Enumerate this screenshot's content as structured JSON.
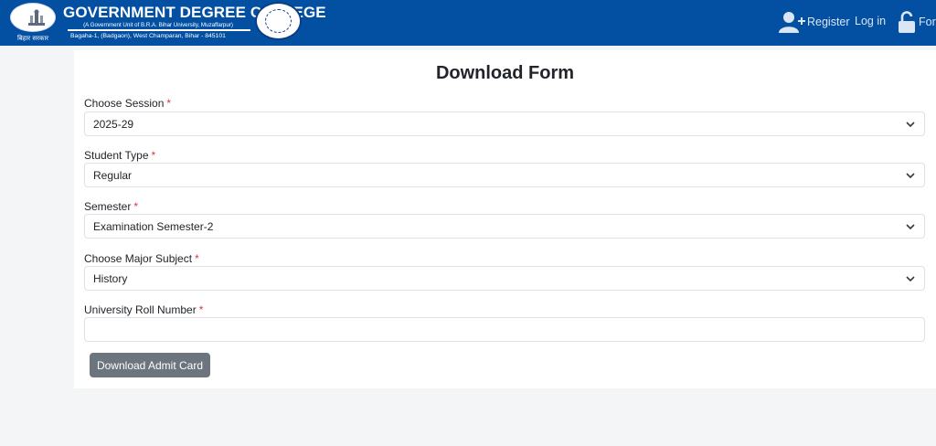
{
  "header": {
    "emblem_text": "बिहार सरकार",
    "college_name": "GOVERNMENT DEGREE COLLEGE",
    "college_subtitle": "(A Government Unit of B.R.A. Bihar University, Muzaffarpur)",
    "college_address": "Bagaha-1, (Badgaon), West Champaran, Bihar - 845101",
    "colors": {
      "background": "#0350a3"
    }
  },
  "nav": {
    "register_label": "Register",
    "register_icon": "user-plus-icon",
    "login_label": "Log in",
    "form_label": "For",
    "form_icon": "unlock-icon"
  },
  "form": {
    "title": "Download Form",
    "required_mark": "*",
    "session": {
      "label": "Choose Session",
      "value": "2025-29"
    },
    "student_type": {
      "label": "Student Type",
      "value": "Regular"
    },
    "semester": {
      "label": "Semester",
      "value": "Examination Semester-2"
    },
    "major_subject": {
      "label": "Choose Major Subject",
      "value": "History"
    },
    "roll_number": {
      "label": "University Roll Number",
      "value": "",
      "placeholder": ""
    },
    "submit_label": "Download Admit Card",
    "colors": {
      "required": "#dc3545",
      "button": "#6c757d"
    }
  }
}
